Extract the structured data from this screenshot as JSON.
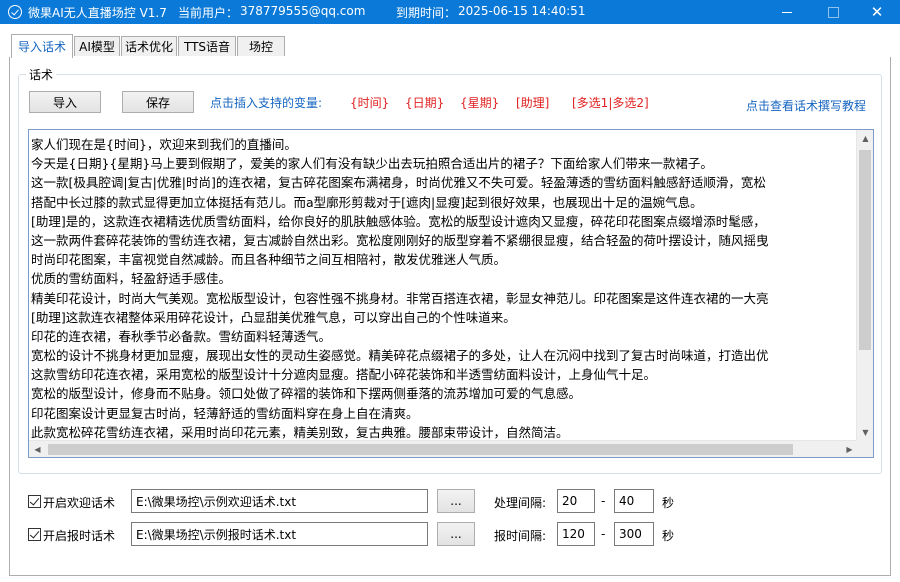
{
  "window": {
    "title": "微果AI无人直播场控 V1.7",
    "user_label": "当前用户：",
    "user": "378779555@qq.com",
    "expire_label": "到期时间：",
    "expire": "2025-06-15 14:40:51",
    "min_glyph": "",
    "max_glyph": "",
    "close_glyph": "✕"
  },
  "tabs": [
    "导入话术",
    "AI模型",
    "话术优化",
    "TTS语音",
    "场控"
  ],
  "script_group": {
    "legend": "话术",
    "import_button": "导入",
    "save_button": "保存",
    "vars_label": "点击插入支持的变量:",
    "variables": [
      "{时间}",
      "{日期}",
      "{星期}",
      "[助理]",
      "[多选1|多选2]"
    ],
    "help_link": "点击查看话术撰写教程"
  },
  "editor": {
    "lines": [
      "家人们现在是{时间}，欢迎来到我们的直播间。",
      "今天是{日期}{星期}马上要到假期了，爱美的家人们有没有缺少出去玩拍照合适出片的裙子？下面给家人们带来一款裙子。",
      "这一款[极具腔调|复古|优雅|时尚]的连衣裙，复古碎花图案布满裙身，时尚优雅又不失可爱。轻盈薄透的雪纺面料触感舒适顺滑，宽松",
      "搭配中长过膝的款式显得更加立体挺括有范儿。而a型廓形剪裁对于[遮肉|显瘦]起到很好效果，也展现出十足的温婉气息。",
      "[助理]是的，这款连衣裙精选优质雪纺面料，给你良好的肌肤触感体验。宽松的版型设计遮肉又显瘦，碎花印花图案点缀增添时髦感，",
      "这一款两件套碎花装饰的雪纺连衣裙，复古减龄自然出彩。宽松度刚刚好的版型穿着不紧绷很显瘦，结合轻盈的荷叶摆设计，随风摇曳",
      "时尚印花图案，丰富视觉自然减龄。而且各种细节之间互相陪衬，散发优雅迷人气质。",
      "优质的雪纺面料，轻盈舒适手感佳。",
      "精美印花设计，时尚大气美观。宽松版型设计，包容性强不挑身材。非常百搭连衣裙，彰显女神范儿。印花图案是这件连衣裙的一大亮",
      "[助理]这款连衣裙整体采用碎花设计，凸显甜美优雅气息，可以穿出自己的个性味道来。",
      "印花的连衣裙，春秋季节必备款。雪纺面料轻薄透气。",
      "宽松的设计不挑身材更加显瘦，展现出女性的灵动生姿感觉。精美碎花点缀裙子的多处，让人在沉闷中找到了复古时尚味道，打造出优",
      "这款雪纺印花连衣裙，采用宽松的版型设计十分遮肉显瘦。搭配小碎花装饰和半透雪纺面料设计，上身仙气十足。",
      "宽松的版型设计，修身而不贴身。领口处做了碎褶的装饰和下摆两侧垂落的流苏增加可爱的气息感。",
      "印花图案设计更显复古时尚，轻薄舒适的雪纺面料穿在身上自在清爽。",
      "此款宽松碎花雪纺连衣裙，采用时尚印花元素，精美别致，复古典雅。腰部束带设计，自然简洁。"
    ]
  },
  "options": {
    "welcome": {
      "label": "开启欢迎话术",
      "path": "E:\\微果场控\\示例欢迎话术.txt",
      "browse": "...",
      "interval_label": "处理间隔:",
      "min": "20",
      "max": "40",
      "unit": "秒",
      "dash": "-"
    },
    "timer": {
      "label": "开启报时话术",
      "path": "E:\\微果场控\\示例报时话术.txt",
      "browse": "...",
      "interval_label": "报时间隔:",
      "min": "120",
      "max": "300",
      "unit": "秒",
      "dash": "-"
    }
  },
  "colors": {
    "titlebar": "#0a79d8",
    "accent_blue": "#1565c0",
    "variable_red": "#e02020"
  }
}
